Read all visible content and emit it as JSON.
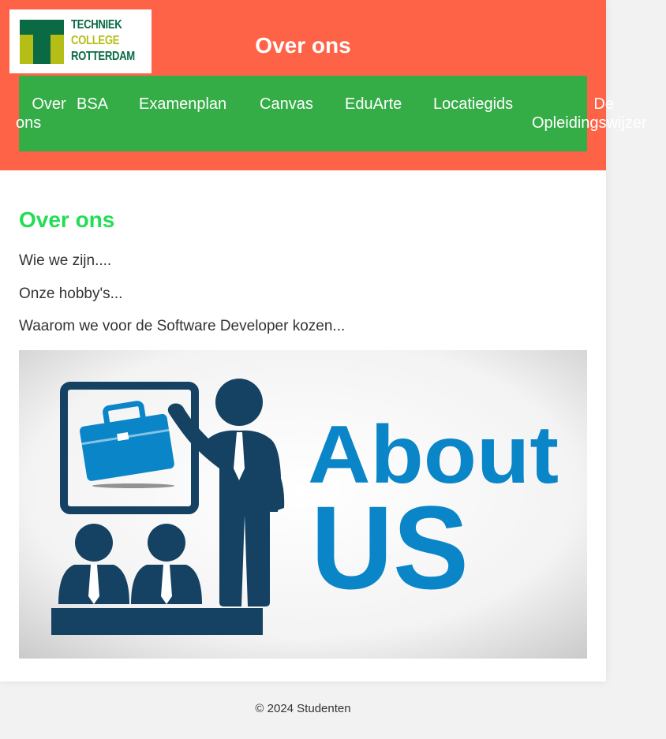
{
  "logo": {
    "line1": "TECHNIEK",
    "line2": "COLLEGE",
    "line3": "ROTTERDAM"
  },
  "header": {
    "title": "Over ons"
  },
  "nav": {
    "items": [
      {
        "line1": "Over",
        "line2": "ons"
      },
      {
        "label": "BSA"
      },
      {
        "label": "Examenplan"
      },
      {
        "label": "Canvas"
      },
      {
        "label": "EduArte"
      },
      {
        "label": "Locatiegids"
      },
      {
        "line1": "De",
        "line2": "Opleidingswijzer"
      }
    ]
  },
  "main": {
    "heading": "Over ons",
    "paragraphs": [
      "Wie we zijn....",
      "Onze hobby's...",
      "Waarom we voor de Software Developer kozen..."
    ]
  },
  "hero": {
    "line1": "About",
    "line2": "US"
  },
  "footer": {
    "text": "© 2024 Studenten"
  },
  "colors": {
    "header_bg": "#ff6347",
    "nav_bg": "#34ad47",
    "heading": "#22dd55",
    "logo_green": "#0a6a44",
    "logo_yellow": "#b5be14",
    "hero_navy": "#154263",
    "hero_blue": "#0a86c8"
  }
}
